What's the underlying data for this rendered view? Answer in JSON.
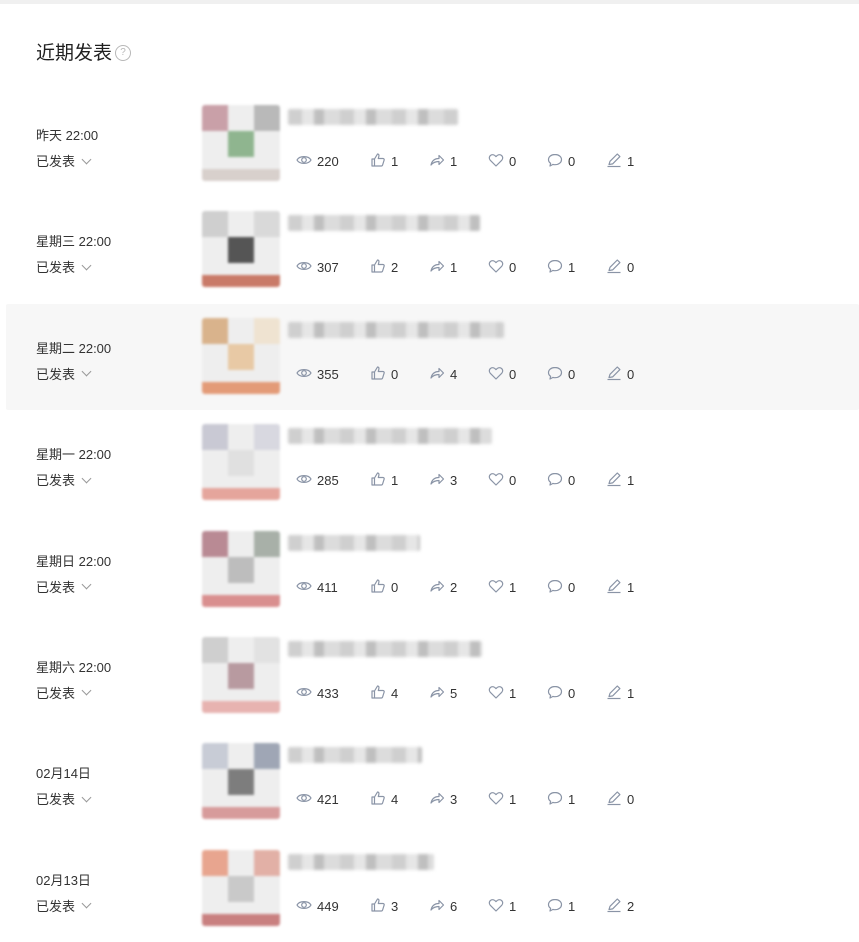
{
  "section": {
    "title": "近期发表",
    "help_icon": "question-circle-icon"
  },
  "colors": {
    "text": "#333333",
    "icon": "#8a94a6",
    "hover_row_bg": "#f7f7f7"
  },
  "posts": [
    {
      "time": "昨天 22:00",
      "status": "已发表",
      "views": "220",
      "likes": "1",
      "shares": "1",
      "favorites": "0",
      "comments": "0",
      "notes": "1"
    },
    {
      "time": "星期三 22:00",
      "status": "已发表",
      "views": "307",
      "likes": "2",
      "shares": "1",
      "favorites": "0",
      "comments": "1",
      "notes": "0"
    },
    {
      "time": "星期二 22:00",
      "status": "已发表",
      "views": "355",
      "likes": "0",
      "shares": "4",
      "favorites": "0",
      "comments": "0",
      "notes": "0"
    },
    {
      "time": "星期一 22:00",
      "status": "已发表",
      "views": "285",
      "likes": "1",
      "shares": "3",
      "favorites": "0",
      "comments": "0",
      "notes": "1"
    },
    {
      "time": "星期日 22:00",
      "status": "已发表",
      "views": "411",
      "likes": "0",
      "shares": "2",
      "favorites": "1",
      "comments": "0",
      "notes": "1"
    },
    {
      "time": "星期六 22:00",
      "status": "已发表",
      "views": "433",
      "likes": "4",
      "shares": "5",
      "favorites": "1",
      "comments": "0",
      "notes": "1"
    },
    {
      "time": "02月14日",
      "status": "已发表",
      "views": "421",
      "likes": "4",
      "shares": "3",
      "favorites": "1",
      "comments": "1",
      "notes": "0"
    },
    {
      "time": "02月13日",
      "status": "已发表",
      "views": "449",
      "likes": "3",
      "shares": "6",
      "favorites": "1",
      "comments": "1",
      "notes": "2"
    }
  ],
  "stat_icons": [
    "eye-icon",
    "thumbs-up-icon",
    "share-arrow-icon",
    "heart-icon",
    "comment-bubble-icon",
    "pen-icon"
  ]
}
